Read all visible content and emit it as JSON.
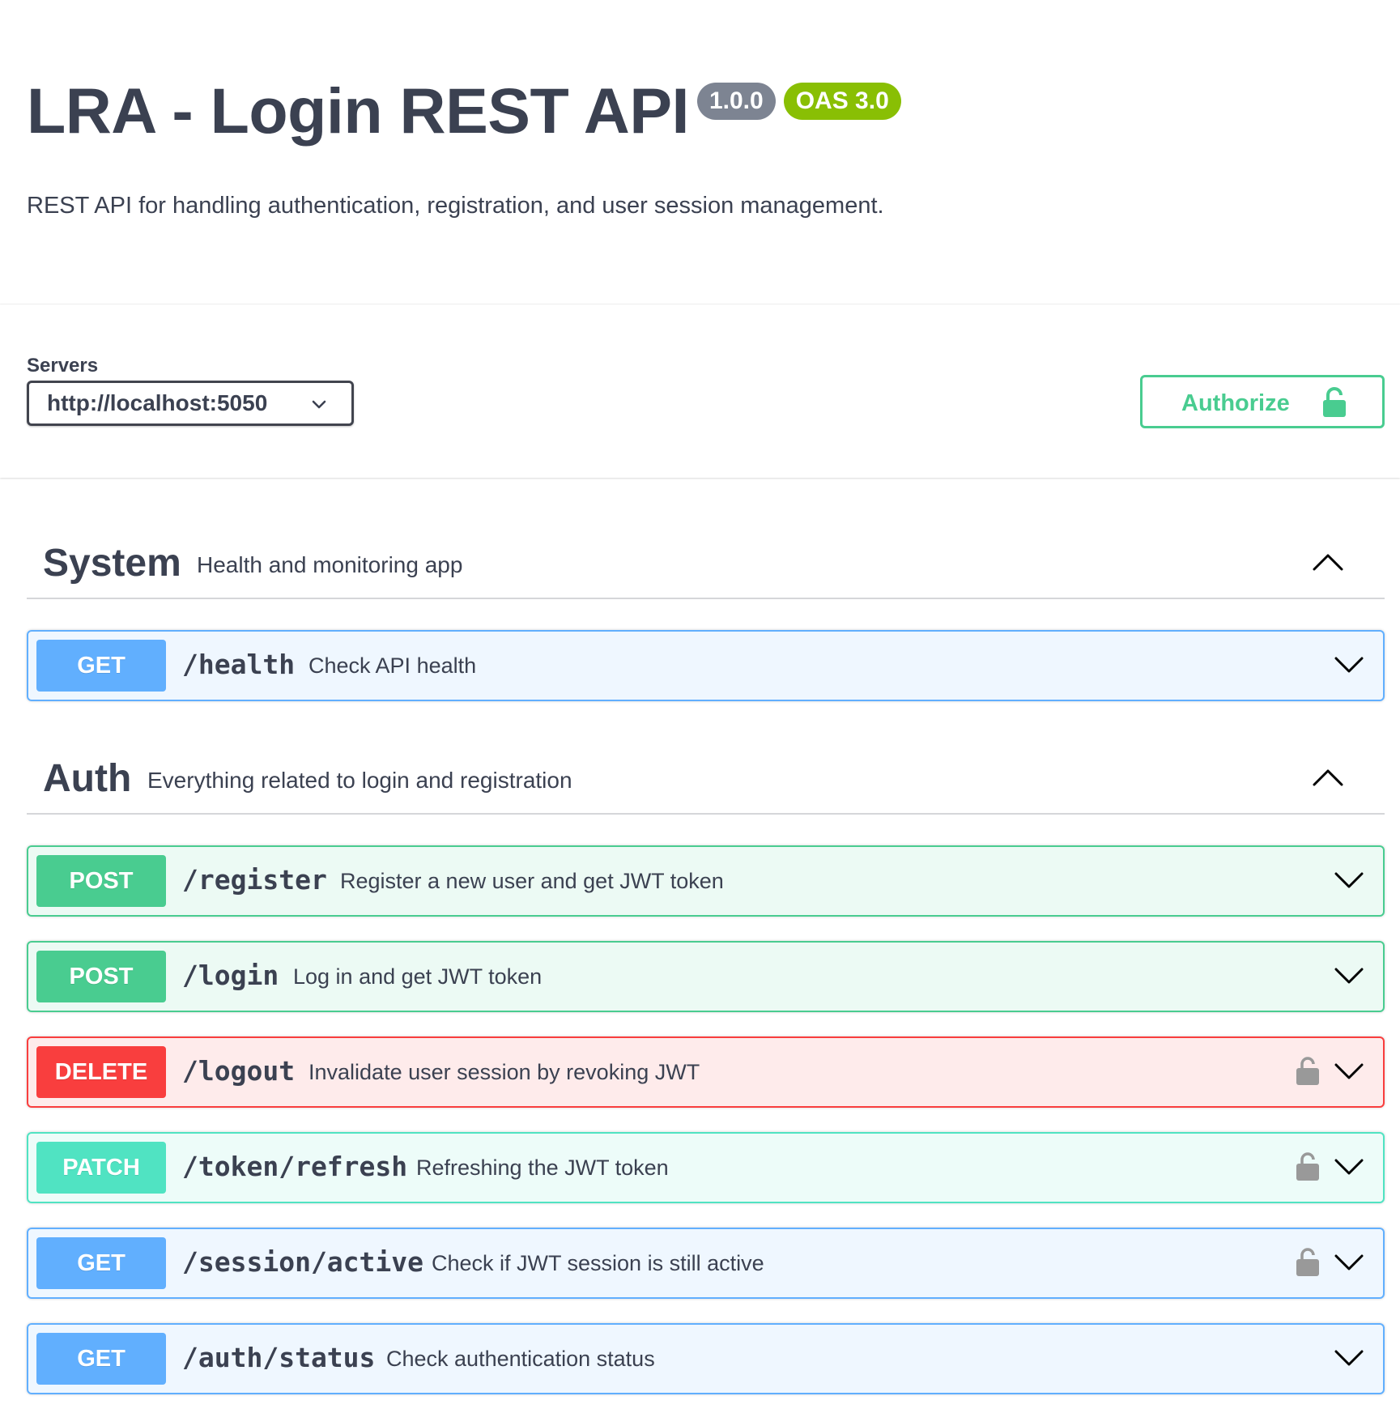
{
  "info": {
    "title": "LRA - Login REST API",
    "version": "1.0.0",
    "oas": "OAS 3.0",
    "description": "REST API for handling authentication, registration, and user session management."
  },
  "servers": {
    "label": "Servers",
    "selected": "http://localhost:5050"
  },
  "authorize": {
    "label": "Authorize",
    "icon": "unlocked-padlock-icon"
  },
  "colors": {
    "get": "#61affe",
    "post": "#49cc90",
    "delete": "#f93e3e",
    "patch": "#50e3c2",
    "text": "#3b4151",
    "version_badge": "#7d8492",
    "oas_badge": "#89bf04"
  },
  "tags": [
    {
      "name": "System",
      "description": "Health and monitoring app",
      "expanded": true,
      "operations": [
        {
          "method": "GET",
          "path": "/health",
          "summary": "Check API health",
          "locked": false
        }
      ]
    },
    {
      "name": "Auth",
      "description": "Everything related to login and registration",
      "expanded": true,
      "operations": [
        {
          "method": "POST",
          "path": "/register",
          "summary": "Register a new user and get JWT token",
          "locked": false
        },
        {
          "method": "POST",
          "path": "/login",
          "summary": "Log in and get JWT token",
          "locked": false
        },
        {
          "method": "DELETE",
          "path": "/logout",
          "summary": "Invalidate user session by revoking JWT",
          "locked": true
        },
        {
          "method": "PATCH",
          "path": "/token/refresh",
          "summary": "Refreshing the JWT token",
          "locked": true
        },
        {
          "method": "GET",
          "path": "/session/active",
          "summary": "Check if JWT session is still active",
          "locked": true
        },
        {
          "method": "GET",
          "path": "/auth/status",
          "summary": "Check authentication status",
          "locked": false
        }
      ]
    }
  ]
}
